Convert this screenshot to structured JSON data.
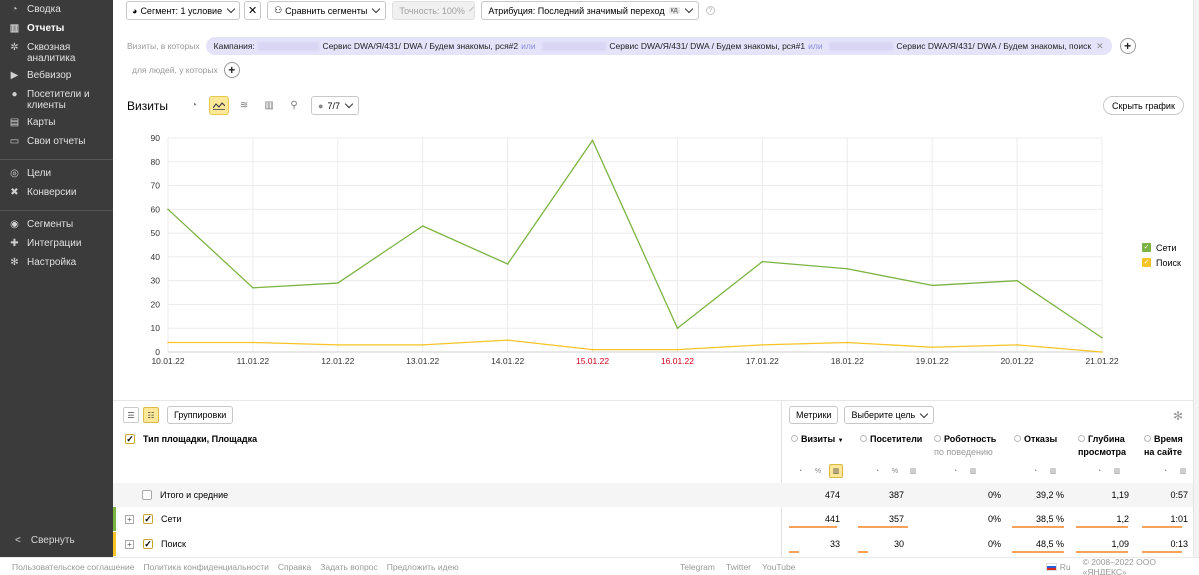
{
  "sidebar": {
    "items": [
      {
        "label": "Сводка",
        "icon": "dashboard-icon",
        "glyph": "◔"
      },
      {
        "label": "Отчеты",
        "icon": "bar-chart-icon",
        "glyph": "▥",
        "active": true
      },
      {
        "label": "Сквозная аналитика",
        "icon": "network-icon",
        "glyph": "✲"
      },
      {
        "label": "Вебвизор",
        "icon": "play-icon",
        "glyph": "▶"
      },
      {
        "label": "Посетители и клиенты",
        "icon": "person-icon",
        "glyph": "●"
      },
      {
        "label": "Карты",
        "icon": "map-icon",
        "glyph": "▤"
      },
      {
        "label": "Свои отчеты",
        "icon": "custom-report-icon",
        "glyph": "▭"
      },
      {
        "label": "Цели",
        "icon": "target-icon",
        "glyph": "◎"
      },
      {
        "label": "Конверсии",
        "icon": "conversion-icon",
        "glyph": "✖"
      },
      {
        "label": "Сегменты",
        "icon": "segments-icon",
        "glyph": "◉"
      },
      {
        "label": "Интеграции",
        "icon": "puzzle-icon",
        "glyph": "✚"
      },
      {
        "label": "Настройка",
        "icon": "gear-icon",
        "glyph": "✻"
      }
    ],
    "collapse_label": "Свернуть"
  },
  "topbar": {
    "segment_label": "Сегмент: 1 условие",
    "compare_label": "Сравнить сегменты",
    "accuracy_label": "Точность: 100%",
    "attribution_label": "Атрибуция: Последний значимый переход",
    "attribution_badge": "кд"
  },
  "segment_filter": {
    "prefix": "Визиты, в которых",
    "campaign_label": "Кампания:",
    "campaign_1": "Сервис DWA/Я/431/ DWA / Будем знакомы, рся#2",
    "or_1": "или",
    "campaign_2": "Сервис DWA/Я/431/ DWA / Будем знакомы, рся#1",
    "or_2": "или",
    "campaign_3": "Сервис DWA/Я/431/ DWA / Будем знакомы, поиск",
    "people_prefix": "для людей, у которых"
  },
  "chart_header": {
    "title": "Визиты",
    "filter_count": "7/7",
    "hide_label": "Скрыть график"
  },
  "chart_data": {
    "type": "line",
    "categories": [
      "10.01.22",
      "11.01.22",
      "12.01.22",
      "13.01.22",
      "14.01.22",
      "15.01.22",
      "16.01.22",
      "17.01.22",
      "18.01.22",
      "19.01.22",
      "20.01.22",
      "21.01.22"
    ],
    "weekend_categories": [
      "15.01.22",
      "16.01.22"
    ],
    "series": [
      {
        "name": "Сети",
        "color": "#7cb342",
        "values": [
          60,
          27,
          29,
          53,
          37,
          89,
          10,
          38,
          35,
          28,
          30,
          6
        ]
      },
      {
        "name": "Поиск",
        "color": "#f7c325",
        "values": [
          4,
          4,
          3,
          3,
          5,
          1,
          1,
          3,
          4,
          2,
          3,
          0
        ]
      }
    ],
    "ylim": [
      0,
      90
    ],
    "yticks": [
      0,
      10,
      20,
      30,
      40,
      50,
      60,
      70,
      80,
      90
    ],
    "grid": true,
    "legend": "right"
  },
  "table": {
    "groupings_label": "Группировки",
    "metrics_label": "Метрики",
    "goal_label": "Выберите цель",
    "dimension_header": "Тип площадки, Площадка",
    "columns": [
      {
        "l1": "Визиты",
        "sort": "▼",
        "l2": ""
      },
      {
        "l1": "Посетители",
        "sort": "",
        "l2": ""
      },
      {
        "l1": "Роботность",
        "sort": "",
        "l2": "по поведению"
      },
      {
        "l1": "Отказы",
        "sort": "",
        "l2": ""
      },
      {
        "l1": "Глубина",
        "sort": "",
        "l2": "просмотра"
      },
      {
        "l1": "Время",
        "sort": "",
        "l2": "на сайте"
      }
    ],
    "total_label": "Итого и средние",
    "totals": [
      "474",
      "387",
      "0%",
      "39,2 %",
      "1,19",
      "0:57"
    ],
    "rows": [
      {
        "label": "Сети",
        "values": [
          "441",
          "357",
          "0%",
          "38,5 %",
          "1,2",
          "1:01"
        ],
        "color": "#7cb342"
      },
      {
        "label": "Поиск",
        "values": [
          "33",
          "30",
          "0%",
          "48,5 %",
          "1,09",
          "0:13"
        ],
        "color": "#f7c325"
      }
    ]
  },
  "footer": {
    "links_left": [
      "Пользовательское соглашение",
      "Политика конфиденциальности",
      "Справка",
      "Задать вопрос",
      "Предложить идею"
    ],
    "links_mid": [
      "Telegram",
      "Twitter",
      "YouTube"
    ],
    "lang": "Ru",
    "copyright": "© 2008–2022 ООО «ЯНДЕКС»"
  }
}
